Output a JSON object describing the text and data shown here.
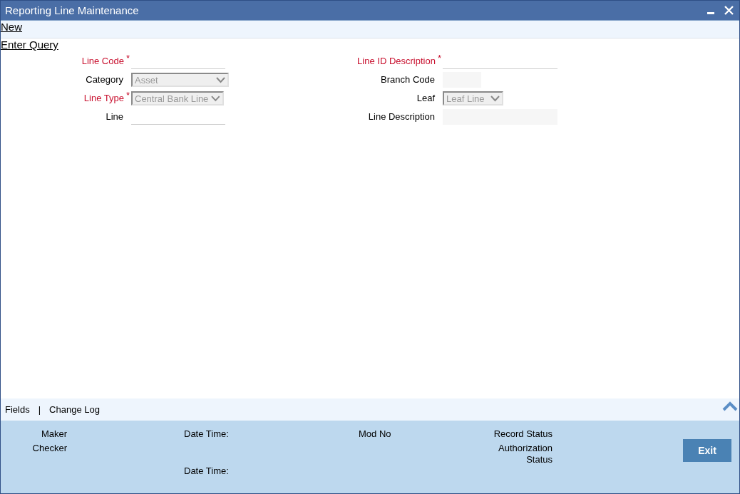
{
  "window": {
    "title": "Reporting Line Maintenance",
    "controls": [
      {
        "kind": "minimize"
      },
      {
        "kind": "close"
      }
    ]
  },
  "toolbar": [
    {
      "label": "New"
    },
    {
      "label": "Enter Query"
    }
  ],
  "form": {
    "left": [
      {
        "label": "Line Code",
        "required": true,
        "marker": "*",
        "kind": "text"
      },
      {
        "label": "Category",
        "required": false,
        "kind": "select",
        "value": "Asset"
      },
      {
        "label": "Line Type",
        "required": true,
        "marker": "*",
        "kind": "select",
        "value": "Central Bank Line"
      },
      {
        "label": "Line",
        "required": false,
        "kind": "text"
      }
    ],
    "right": [
      {
        "label": "Line ID Description",
        "required": true,
        "marker": "*",
        "kind": "text"
      },
      {
        "label": "Branch Code",
        "required": false,
        "kind": "readonly"
      },
      {
        "label": "Leaf",
        "required": false,
        "kind": "select",
        "value": "Leaf Line"
      },
      {
        "label": "Line Description",
        "required": false,
        "kind": "readonly"
      }
    ]
  },
  "footer_tabs": [
    {
      "label": "Fields"
    },
    {
      "label": "Change Log"
    }
  ],
  "footer_separator": "|",
  "audit": {
    "maker": "Maker",
    "checker": "Checker",
    "date_time_1": "Date Time:",
    "date_time_2": "Date Time:",
    "mod_no": "Mod No",
    "record_status": "Record Status",
    "authorization_status": "Authorization Status"
  },
  "buttons": [
    {
      "label": "Exit"
    }
  ]
}
